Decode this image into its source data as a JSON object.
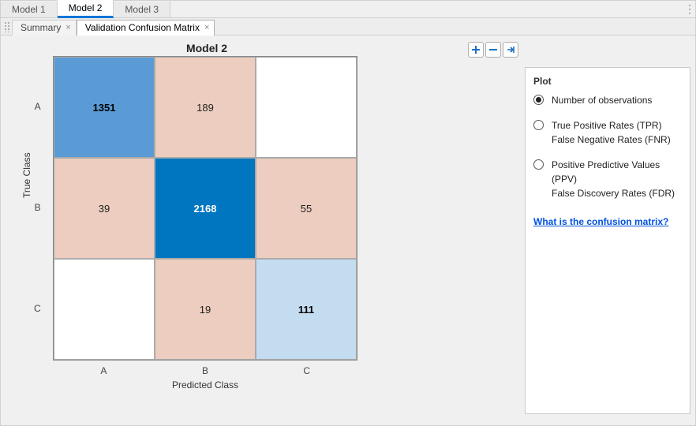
{
  "model_tabs": [
    "Model 1",
    "Model 2",
    "Model 3"
  ],
  "active_model_tab": 1,
  "sub_tabs": [
    "Summary",
    "Validation Confusion Matrix"
  ],
  "active_sub_tab": 1,
  "chart_data": {
    "type": "heatmap",
    "title": "Model 2",
    "xlabel": "Predicted Class",
    "ylabel": "True Class",
    "row_labels": [
      "A",
      "B",
      "C"
    ],
    "col_labels": [
      "A",
      "B",
      "C"
    ],
    "values": [
      [
        1351,
        189,
        null
      ],
      [
        39,
        2168,
        55
      ],
      [
        null,
        19,
        111
      ]
    ],
    "colors": [
      [
        "#5a9bd5",
        "#eccdbf",
        "#ffffff"
      ],
      [
        "#eccdbf",
        "#0076c0",
        "#eccdbf"
      ],
      [
        "#ffffff",
        "#eccdbf",
        "#c4dcf0"
      ]
    ],
    "bold": [
      [
        true,
        false,
        false
      ],
      [
        false,
        true,
        false
      ],
      [
        false,
        false,
        true
      ]
    ],
    "white_text": [
      [
        false,
        false,
        false
      ],
      [
        false,
        true,
        false
      ],
      [
        false,
        false,
        false
      ]
    ]
  },
  "side": {
    "title": "Plot",
    "options": [
      {
        "lines": [
          "Number of observations"
        ],
        "checked": true
      },
      {
        "lines": [
          "True Positive Rates (TPR)",
          "False Negative Rates (FNR)"
        ],
        "checked": false
      },
      {
        "lines": [
          "Positive Predictive Values (PPV)",
          "False Discovery Rates (FDR)"
        ],
        "checked": false
      }
    ],
    "help": "What is the confusion matrix?"
  }
}
